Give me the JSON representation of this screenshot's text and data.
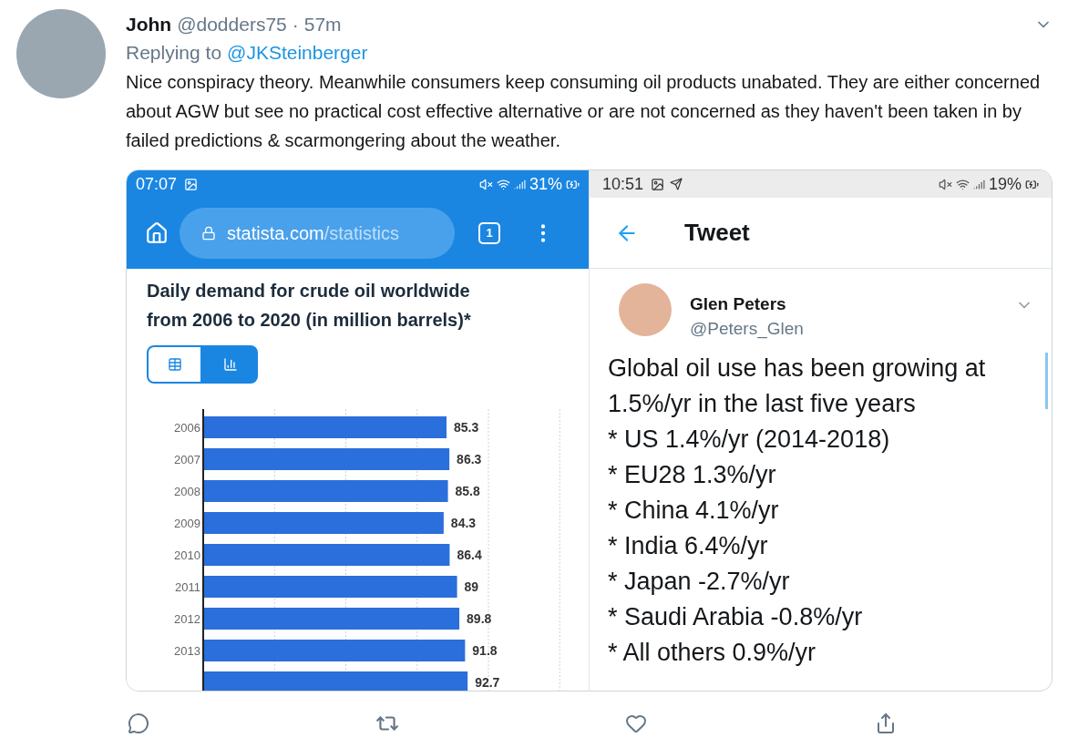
{
  "tweet": {
    "author_name": "John",
    "handle": "@dodders75",
    "separator": "·",
    "time": "57m",
    "replying_label": "Replying to",
    "replying_to": "@JKSteinberger",
    "text": "Nice conspiracy theory. Meanwhile consumers keep consuming oil products unabated. They are either concerned about AGW but see no practical cost effective alternative or are not concerned as they haven't been taken in by failed predictions & scarmongering about the weather."
  },
  "screenshot_left": {
    "status_time": "07:07",
    "battery": "31%",
    "url_domain": "statista.com",
    "url_path": "/statistics",
    "tab_count": "1",
    "title_lines": [
      "Daily demand for crude oil worldwide",
      "from 2006 to 2020 (in million barrels)*"
    ],
    "view_toggle": [
      {
        "kind": "table",
        "selected": false
      },
      {
        "kind": "chart",
        "selected": true
      }
    ],
    "chart_data": {
      "type": "bar",
      "orientation": "horizontal",
      "categories": [
        "2006",
        "2007",
        "2008",
        "2009",
        "2010",
        "2011",
        "2012",
        "2013",
        null
      ],
      "series": [
        {
          "color": "#2a6fdb",
          "values": [
            85.3,
            86.3,
            85.8,
            84.3,
            86.4,
            89,
            89.8,
            91.8,
            92.7
          ]
        }
      ],
      "data_labels": true,
      "value_labels": [
        "85.3",
        "86.3",
        "85.8",
        "84.3",
        "86.4",
        "89",
        "89.8",
        "91.8",
        "92.7"
      ]
    }
  },
  "screenshot_right": {
    "status_time": "10:51",
    "battery": "19%",
    "header_title": "Tweet",
    "author_name": "Glen Peters",
    "handle": "@Peters_Glen",
    "lines": [
      "Global oil use has been growing at",
      "1.5%/yr in the last five years",
      "* US 1.4%/yr (2014-2018)",
      "* EU28 1.3%/yr",
      "* China 4.1%/yr",
      "* India 6.4%/yr",
      "* Japan -2.7%/yr",
      "* Saudi Arabia -0.8%/yr",
      "* All others 0.9%/yr"
    ]
  }
}
